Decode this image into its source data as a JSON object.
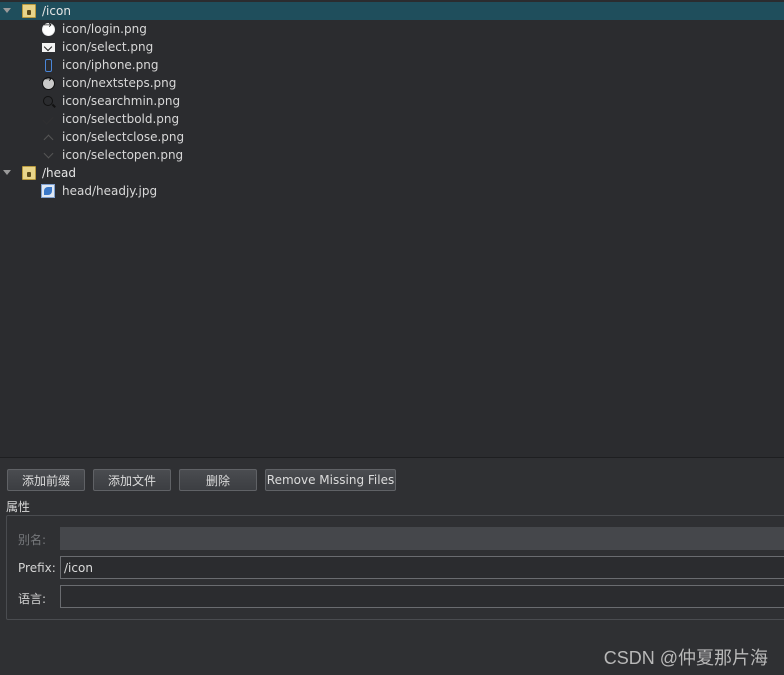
{
  "tree": {
    "groups": [
      {
        "label": "/icon",
        "icon": "folder-lock-icon",
        "expanded": true,
        "selected": true,
        "files": [
          {
            "label": "icon/login.png",
            "icon": "login-icon"
          },
          {
            "label": "icon/select.png",
            "icon": "select-icon"
          },
          {
            "label": "icon/iphone.png",
            "icon": "iphone-icon"
          },
          {
            "label": "icon/nextsteps.png",
            "icon": "nextsteps-icon"
          },
          {
            "label": "icon/searchmin.png",
            "icon": "searchmin-icon"
          },
          {
            "label": "icon/selectbold.png",
            "icon": "selectbold-icon"
          },
          {
            "label": "icon/selectclose.png",
            "icon": "selectclose-icon"
          },
          {
            "label": "icon/selectopen.png",
            "icon": "selectopen-icon"
          }
        ]
      },
      {
        "label": "/head",
        "icon": "folder-lock-icon",
        "expanded": true,
        "selected": false,
        "files": [
          {
            "label": "head/headjy.jpg",
            "icon": "image-file-icon"
          }
        ]
      }
    ]
  },
  "toolbar": {
    "add_prefix": "添加前缀",
    "add_files": "添加文件",
    "delete": "删除",
    "remove_missing": "Remove Missing Files"
  },
  "properties": {
    "title": "属性",
    "alias_label": "别名:",
    "alias_value": "",
    "prefix_label": "Prefix:",
    "prefix_value": "/icon",
    "language_label": "语言:",
    "language_value": ""
  },
  "watermark": "CSDN @仲夏那片海",
  "colors": {
    "background": "#2f3033",
    "selection": "#1f4e5c",
    "folder": "#e8d58a"
  }
}
